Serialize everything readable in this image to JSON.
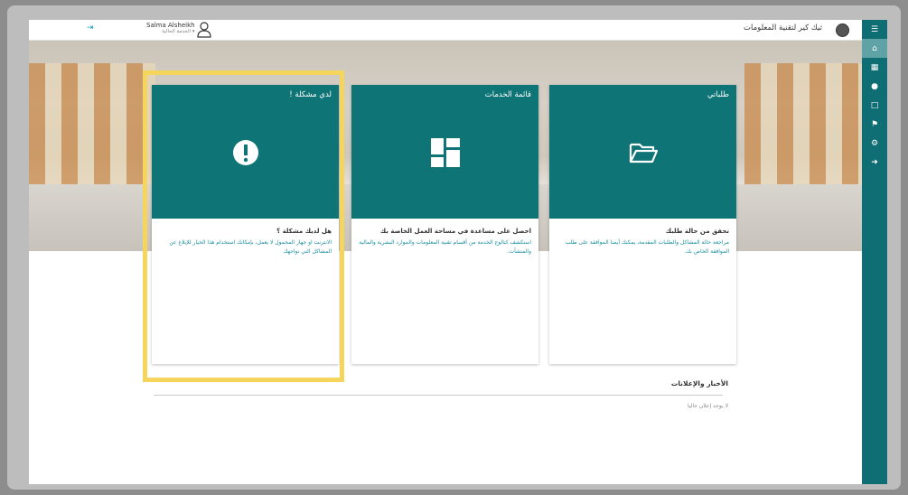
{
  "header": {
    "user_name": "Salma Alsheikh",
    "user_role": "الخدمة الحالية ▾",
    "app_title": "ثيك كير لتقنية المعلومات"
  },
  "sidebar": {
    "items": [
      "menu-icon",
      "home-icon",
      "dashboard-icon",
      "help-icon",
      "folder-icon",
      "announce-icon",
      "settings-icon",
      "logout-icon"
    ]
  },
  "cards": [
    {
      "title": "لدي مشكلة !",
      "subtitle": "هل لديك مشكلة ؟",
      "description": "الانترنت او جهاز المحمول لا يعمل، بإمكانك استخدام هذا الخيار للإبلاغ عن المشاكل التي تواجهك",
      "icon": "exclamation-icon"
    },
    {
      "title": "قائمة الخدمات",
      "subtitle": "احصل على مساعدة في مساحة العمل الخاصة بك",
      "description": "استكشف كتالوج الخدمة من أقسام تقنية المعلومات والموارد البشرية والمالية والمنشآت.",
      "icon": "dashboard-tiles-icon"
    },
    {
      "title": "طلباتي",
      "subtitle": "تحقق من حالة طلبك",
      "description": "مراجعة حالة المشاكل والطلبات المقدمة، يمكنك أيضا الموافقة على طلب الموافقة الخاص بك.",
      "icon": "folder-open-icon"
    }
  ],
  "news": {
    "title": "الأخبار والإعلانات",
    "empty_message": "لا يوجد إعلان حاليا"
  },
  "colors": {
    "primary": "#0f7476",
    "highlight": "#f6d55c",
    "link": "#1a8fa0"
  }
}
